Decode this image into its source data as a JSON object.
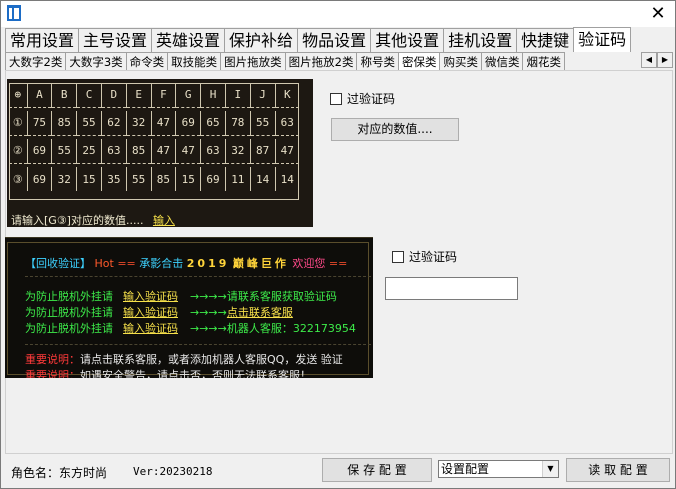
{
  "window": {
    "close_glyph": "✕",
    "app_icon": "app-icon"
  },
  "main_tabs": [
    {
      "label": "常用设置"
    },
    {
      "label": "主号设置"
    },
    {
      "label": "英雄设置"
    },
    {
      "label": "保护补给"
    },
    {
      "label": "物品设置"
    },
    {
      "label": "其他设置"
    },
    {
      "label": "挂机设置"
    },
    {
      "label": "快捷键"
    },
    {
      "label": "验证码",
      "active": true
    }
  ],
  "sub_tabs": [
    {
      "label": "大数字2类"
    },
    {
      "label": "大数字3类"
    },
    {
      "label": "命令类"
    },
    {
      "label": "取技能类"
    },
    {
      "label": "图片拖放类"
    },
    {
      "label": "图片拖放2类"
    },
    {
      "label": "称号类"
    },
    {
      "label": "密保类",
      "active": true
    },
    {
      "label": "购买类"
    },
    {
      "label": "微信类"
    },
    {
      "label": "烟花类"
    }
  ],
  "sub_tab_scroll": {
    "left": "◀",
    "right": "▶"
  },
  "captcha": {
    "header": [
      "⊕",
      "A",
      "B",
      "C",
      "D",
      "E",
      "F",
      "G",
      "H",
      "I",
      "J",
      "K"
    ],
    "rows": [
      [
        "①",
        "75",
        "85",
        "55",
        "62",
        "32",
        "47",
        "69",
        "65",
        "78",
        "55",
        "63"
      ],
      [
        "②",
        "69",
        "55",
        "25",
        "63",
        "85",
        "47",
        "47",
        "63",
        "32",
        "87",
        "47"
      ],
      [
        "③",
        "69",
        "32",
        "15",
        "35",
        "55",
        "85",
        "15",
        "69",
        "11",
        "14",
        "14"
      ]
    ],
    "prompt": "请输入[G③]对应的数值.....",
    "input_link": "输入"
  },
  "right_panel": {
    "pass_captcha_1": "过验证码",
    "value_button": "对应的数值....",
    "pass_captcha_2": "过验证码"
  },
  "game_text": {
    "header_prefix": "【回收验证】",
    "hot": "Hot",
    "deco1": "==",
    "header_mid": "承影合击",
    "year": "2019",
    "header_peak": "巅峰巨作",
    "welcome": "欢迎您",
    "deco2": "==",
    "lines": [
      {
        "a": "为防止脱机外挂请",
        "b": "输入验证码",
        "c": "→→→→请联系客服获取验证码"
      },
      {
        "a": "为防止脱机外挂请",
        "b": "输入验证码",
        "c": "→→→→",
        "d": "点击联系客服"
      },
      {
        "a": "为防止脱机外挂请",
        "b": "输入验证码",
        "c": "→→→→机器人客服：322173954"
      }
    ],
    "note1_label": "重要说明：",
    "note1_text": "请点击联系客服，或者添加机器人客服QQ，发送 验证",
    "note2_label": "重要说明：",
    "note2_text": "如遇安全警告，请点击否，否则无法联系客服！"
  },
  "status": {
    "role_label": "角色名：东方时尚",
    "version": "Ver:20230218",
    "save_button": "保 存 配 置",
    "config_select": "设置配置",
    "select_arrow": "▼",
    "load_button": "读 取 配 置"
  }
}
